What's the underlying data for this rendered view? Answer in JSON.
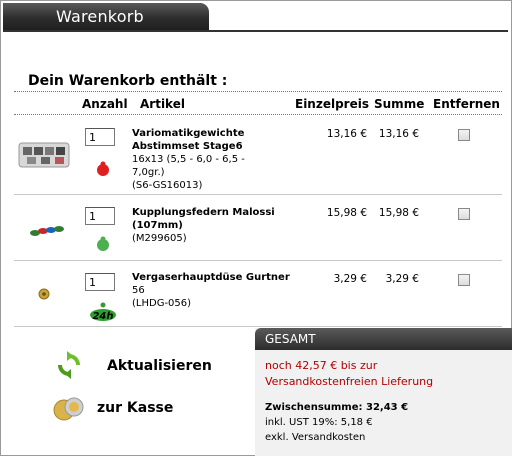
{
  "page": {
    "title": "Warenkorb",
    "heading": "Dein Warenkorb enthält :"
  },
  "columns": {
    "qty": "Anzahl",
    "item": "Artikel",
    "unit_price": "Einzelpreis",
    "total": "Summe",
    "remove": "Entfernen"
  },
  "items": [
    {
      "qty": "1",
      "name_line1": "Variomatikgewichte",
      "name_line2": "Abstimmset Stage6",
      "desc_line1": "16x13 (5,5 - 6,0 - 6,5 -",
      "desc_line2": "7,0gr.)",
      "sku": "(S6-GS16013)",
      "unit_price": "13,16 €",
      "total": "13,16 €",
      "badge_color": "#e02020"
    },
    {
      "qty": "1",
      "name_line1": "Kupplungsfedern Malossi",
      "name_line2": "(107mm)",
      "sku": "(M299605)",
      "unit_price": "15,98 €",
      "total": "15,98 €",
      "badge_color": "#4caf50"
    },
    {
      "qty": "1",
      "name_line1": "Vergaserhauptdüse Gurtner",
      "desc_line1": "56",
      "sku": "(LHDG-056)",
      "unit_price": "3,29 €",
      "total": "3,29 €",
      "badge_color": "#2e9e2e",
      "badge_text": "24h"
    }
  ],
  "actions": {
    "update": "Aktualisieren",
    "checkout": "zur Kasse"
  },
  "summary": {
    "title": "GESAMT",
    "shipping_line1": "noch 42,57 € bis zur",
    "shipping_line2": "Versandkostenfreien Lieferung",
    "subtotal": "Zwischensumme: 32,43 €",
    "vat": "inkl. UST 19%: 5,18 €",
    "shipping_note": "exkl. Versandkosten"
  }
}
